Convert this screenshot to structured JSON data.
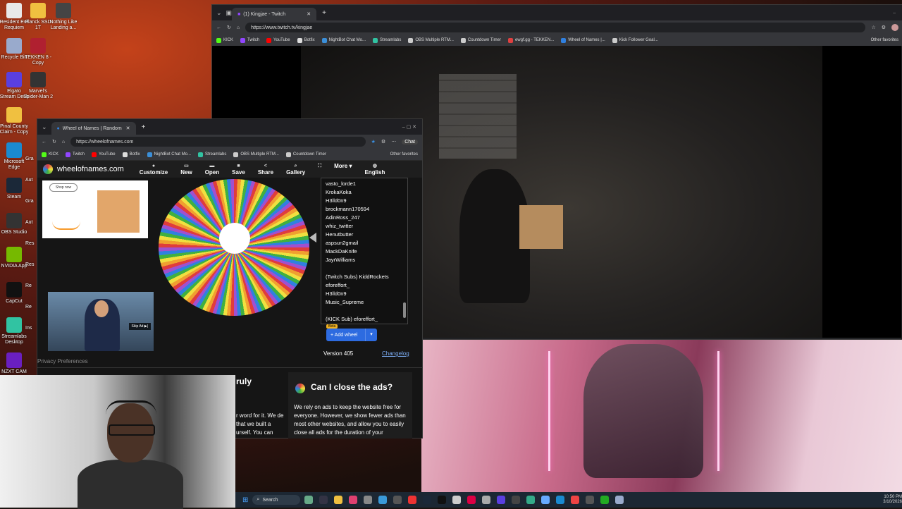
{
  "desktop": {
    "icons": [
      {
        "label": "Resident Evil Requiem",
        "color": "#e8e8e8"
      },
      {
        "label": "Planck SSD 1T",
        "color": "#f0c040"
      },
      {
        "label": "Nothing Like Landing a...",
        "color": "#444"
      },
      {
        "label": "Recycle Bin",
        "color": "#9ac"
      },
      {
        "label": "TEKKEN 8 - Copy",
        "color": "#b02030"
      },
      {
        "label": "Elgato Stream Deck",
        "color": "#5a3fe0"
      },
      {
        "label": "Marvel's Spider-Man 2",
        "color": "#333"
      },
      {
        "label": "Pinal County Claim - Copy",
        "color": "#f0c040"
      },
      {
        "label": "Microsoft Edge",
        "color": "#1a8ad0"
      },
      {
        "label": "Steam",
        "color": "#1b2838"
      },
      {
        "label": "OBS Studio",
        "color": "#333"
      },
      {
        "label": "NVIDIA App",
        "color": "#76b900"
      },
      {
        "label": "CapCut",
        "color": "#111"
      },
      {
        "label": "Streamlabs Desktop",
        "color": "#31c3a2"
      },
      {
        "label": "NZXT CAM",
        "color": "#6a1fc0"
      }
    ],
    "partial_labels": [
      "Gra",
      "Aut",
      "Gra",
      "Aut",
      "Res",
      "Res",
      "Re",
      "Re",
      "Ins"
    ]
  },
  "twitch_window": {
    "tab_title": "(1) Kingjae - Twitch",
    "url": "https://www.twitch.tv/kingjae",
    "favorites": [
      {
        "label": "KICK",
        "color": "#53fc18"
      },
      {
        "label": "Twitch",
        "color": "#9146ff"
      },
      {
        "label": "YouTube",
        "color": "#ff0000"
      },
      {
        "label": "Botfix",
        "color": "#ddd"
      },
      {
        "label": "NightBot Chat Mo...",
        "color": "#3b8fd9"
      },
      {
        "label": "Streamlabs",
        "color": "#31c3a2"
      },
      {
        "label": "OBS Multiple RTM...",
        "color": "#ccc"
      },
      {
        "label": "Countdown Timer",
        "color": "#ccc"
      },
      {
        "label": "ewgf.gg - TEKKEN...",
        "color": "#e04040"
      },
      {
        "label": "Wheel of Names |...",
        "color": "#3080e0"
      },
      {
        "label": "Kick Follower Goal...",
        "color": "#ccc"
      }
    ],
    "other_favorites": "Other favorites"
  },
  "wheel_window": {
    "tab_title": "Wheel of Names | Random name",
    "url": "https://wheelofnames.com",
    "chat_label": "Chat",
    "favorites": [
      {
        "label": "KICK",
        "color": "#53fc18"
      },
      {
        "label": "Twitch",
        "color": "#9146ff"
      },
      {
        "label": "YouTube",
        "color": "#ff0000"
      },
      {
        "label": "Botfix",
        "color": "#ddd"
      },
      {
        "label": "NightBot Chat Mo...",
        "color": "#3b8fd9"
      },
      {
        "label": "Streamlabs",
        "color": "#31c3a2"
      },
      {
        "label": "OBS Multiple RTM...",
        "color": "#ccc"
      },
      {
        "label": "Countdown Timer",
        "color": "#ccc"
      }
    ],
    "other_favorites": "Other favorites",
    "site_name": "wheelofnames.com",
    "nav": [
      {
        "label": "Customize",
        "icon": "palette-icon",
        "glyph": "●"
      },
      {
        "label": "New",
        "icon": "new-file-icon",
        "glyph": "▭"
      },
      {
        "label": "Open",
        "icon": "folder-icon",
        "glyph": "▬"
      },
      {
        "label": "Save",
        "icon": "save-icon",
        "glyph": "■"
      },
      {
        "label": "Share",
        "icon": "share-icon",
        "glyph": "<"
      },
      {
        "label": "Gallery",
        "icon": "search-icon",
        "glyph": "⌕"
      },
      {
        "label": "",
        "icon": "fullscreen-icon",
        "glyph": "⛶"
      },
      {
        "label": "More ▾",
        "icon": "more-icon",
        "glyph": ""
      },
      {
        "label": "English",
        "icon": "globe-icon",
        "glyph": "◍"
      }
    ],
    "ad_shop_now": "Shop now",
    "skip_ad": "Skip Ad ▶|",
    "privacy": "Privacy Preferences",
    "entries": [
      "vasto_lorde1",
      "KrokaKoka",
      "H3lld0n9",
      "brockmann170594",
      "AdinRoss_247",
      "whiz_twitter",
      "Henutbutter",
      "aspsun2gmail",
      "MackDaKnife",
      "JayrWilliams",
      "",
      "(Twitch Subs) KiddRockets",
      "eforeffort_",
      "H3lld0n9",
      "Music_Supreme",
      "",
      "(KICK Sub) eforeffort_"
    ],
    "beta": "Beta",
    "add_wheel": "Add wheel",
    "version": "Version 405",
    "changelog": "Changelog",
    "faq_left_title": "ruly",
    "faq_left_text": "r word for it. We de that we built a urself. You can",
    "faq_title": "Can I close the ads?",
    "faq_text": "We rely on ads to keep the website free for everyone. However, we show fewer ads than most other websites, and allow you to easily close all ads for the duration of your"
  },
  "taskbar": {
    "search": "Search",
    "time": "10:50 PM",
    "date": "3/10/2026"
  }
}
